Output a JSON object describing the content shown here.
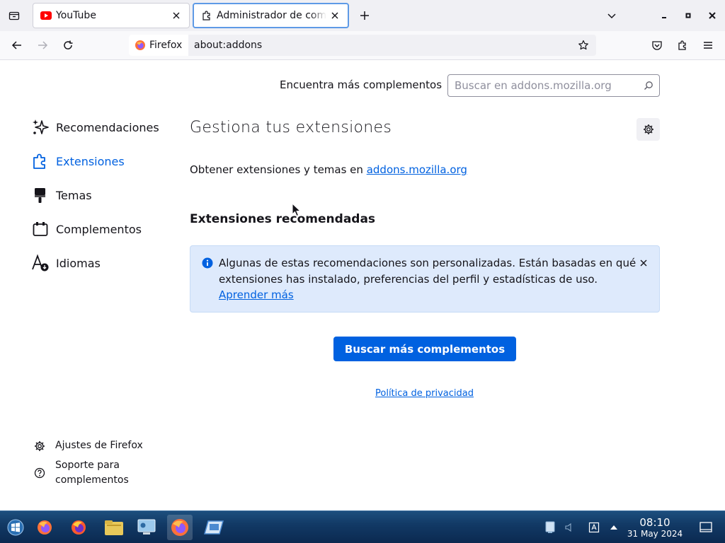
{
  "browser": {
    "tabs": [
      {
        "title": "YouTube",
        "favicon": "youtube-icon",
        "active": false
      },
      {
        "title": "Administrador de complementos",
        "favicon": "puzzle-icon",
        "active": true
      }
    ],
    "identity_label": "Firefox",
    "url": "about:addons"
  },
  "addons": {
    "find_more_label": "Encuentra más complementos",
    "search_placeholder": "Buscar en addons.mozilla.org",
    "categories": [
      {
        "label": "Recomendaciones",
        "icon": "sparkle-icon",
        "selected": false
      },
      {
        "label": "Extensiones",
        "icon": "puzzle-icon",
        "selected": true
      },
      {
        "label": "Temas",
        "icon": "paintbrush-icon",
        "selected": false
      },
      {
        "label": "Complementos",
        "icon": "plugin-icon",
        "selected": false
      },
      {
        "label": "Idiomas",
        "icon": "language-icon",
        "selected": false
      }
    ],
    "footer_links": [
      {
        "label": "Ajustes de Firefox",
        "icon": "gear-icon"
      },
      {
        "label": "Soporte para complementos",
        "icon": "help-icon"
      }
    ],
    "heading": "Gestiona tus extensiones",
    "get_text": "Obtener extensiones y temas en ",
    "get_link": "addons.mozilla.org",
    "recommended_heading": "Extensiones recomendadas",
    "notice_text": "Algunas de estas recomendaciones son personalizadas. Están basadas en qué extensiones has instalado, preferencias del perfil y estadísticas de uso.",
    "notice_link": "Aprender más",
    "find_more_button": "Buscar más complementos",
    "privacy_link": "Política de privacidad"
  },
  "taskbar": {
    "time": "08:10",
    "date": "31 May 2024"
  },
  "colors": {
    "accent": "#0061e0",
    "notice_bg": "#deeafc",
    "taskbar": "#123a66"
  }
}
